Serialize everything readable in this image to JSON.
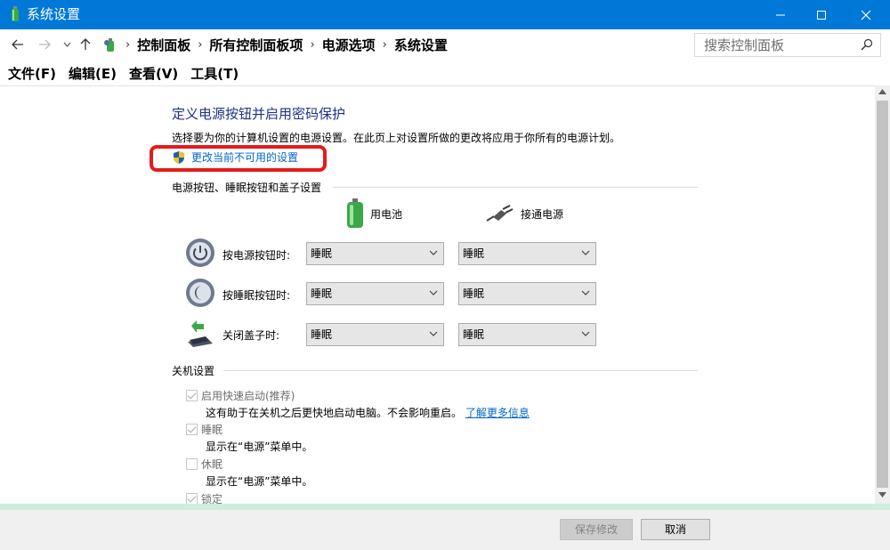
{
  "window": {
    "title": "系统设置",
    "accent_color": "#0078d7",
    "buttons": [
      "minimize-icon",
      "maximize-icon",
      "close-icon"
    ]
  },
  "address_bar": {
    "breadcrumbs": [
      "控制面板",
      "所有控制面板项",
      "电源选项",
      "系统设置"
    ],
    "search_placeholder": "搜索控制面板",
    "nav_icons": [
      "back-arrow-icon",
      "forward-arrow-icon",
      "recent-dropdown-icon",
      "up-arrow-icon"
    ]
  },
  "menu": [
    "文件(F)",
    "编辑(E)",
    "查看(V)",
    "工具(T)"
  ],
  "page": {
    "heading": "定义电源按钮并启用密码保护",
    "description": "选择要为你的计算机设置的电源设置。在此页上对设置所做的更改将应用于你所有的电源计划。",
    "change_link": "更改当前不可用的设置",
    "highlight_color": "#e51a1a"
  },
  "power_buttons": {
    "section_title": "电源按钮、睡眠按钮和盖子设置",
    "column_battery": "用电池",
    "column_plugged": "接通电源",
    "rows": [
      {
        "label": "按电源按钮时:",
        "battery": "睡眠",
        "plugged": "睡眠",
        "icon": "power-button-icon"
      },
      {
        "label": "按睡眠按钮时:",
        "battery": "睡眠",
        "plugged": "睡眠",
        "icon": "sleep-button-icon"
      },
      {
        "label": "关闭盖子时:",
        "battery": "睡眠",
        "plugged": "睡眠",
        "icon": "laptop-lid-icon"
      }
    ]
  },
  "shutdown": {
    "section_title": "关机设置",
    "options": [
      {
        "label": "启用快速启动(推荐)",
        "checked": true,
        "description": "这有助于在关机之后更快地启动电脑。不会影响重启。",
        "link": "了解更多信息"
      },
      {
        "label": "睡眠",
        "checked": true,
        "description": "显示在“电源”菜单中。"
      },
      {
        "label": "休眠",
        "checked": false,
        "description": "显示在“电源”菜单中。"
      },
      {
        "label": "锁定",
        "checked": true
      }
    ]
  },
  "footer": {
    "save_label": "保存修改",
    "cancel_label": "取消"
  }
}
